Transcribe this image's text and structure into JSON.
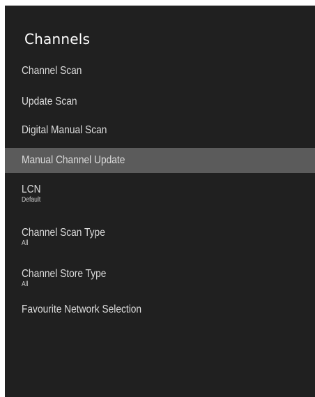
{
  "title": "Channels",
  "items": [
    {
      "label": "Channel Scan",
      "value": "",
      "selected": false
    },
    {
      "label": "Update Scan",
      "value": "",
      "selected": false
    },
    {
      "label": "Digital Manual Scan",
      "value": "",
      "selected": false
    },
    {
      "label": "Manual Channel Update",
      "value": "",
      "selected": true
    },
    {
      "label": "LCN",
      "value": "Default",
      "selected": false
    },
    {
      "label": "Channel Scan Type",
      "value": "All",
      "selected": false
    },
    {
      "label": "Channel Store Type",
      "value": "All",
      "selected": false
    },
    {
      "label": "Favourite Network Selection",
      "value": "",
      "selected": false
    }
  ],
  "colors": {
    "panel_background": "#202020",
    "selected_background": "#5b5b5b",
    "text": "#dcdcdc"
  }
}
